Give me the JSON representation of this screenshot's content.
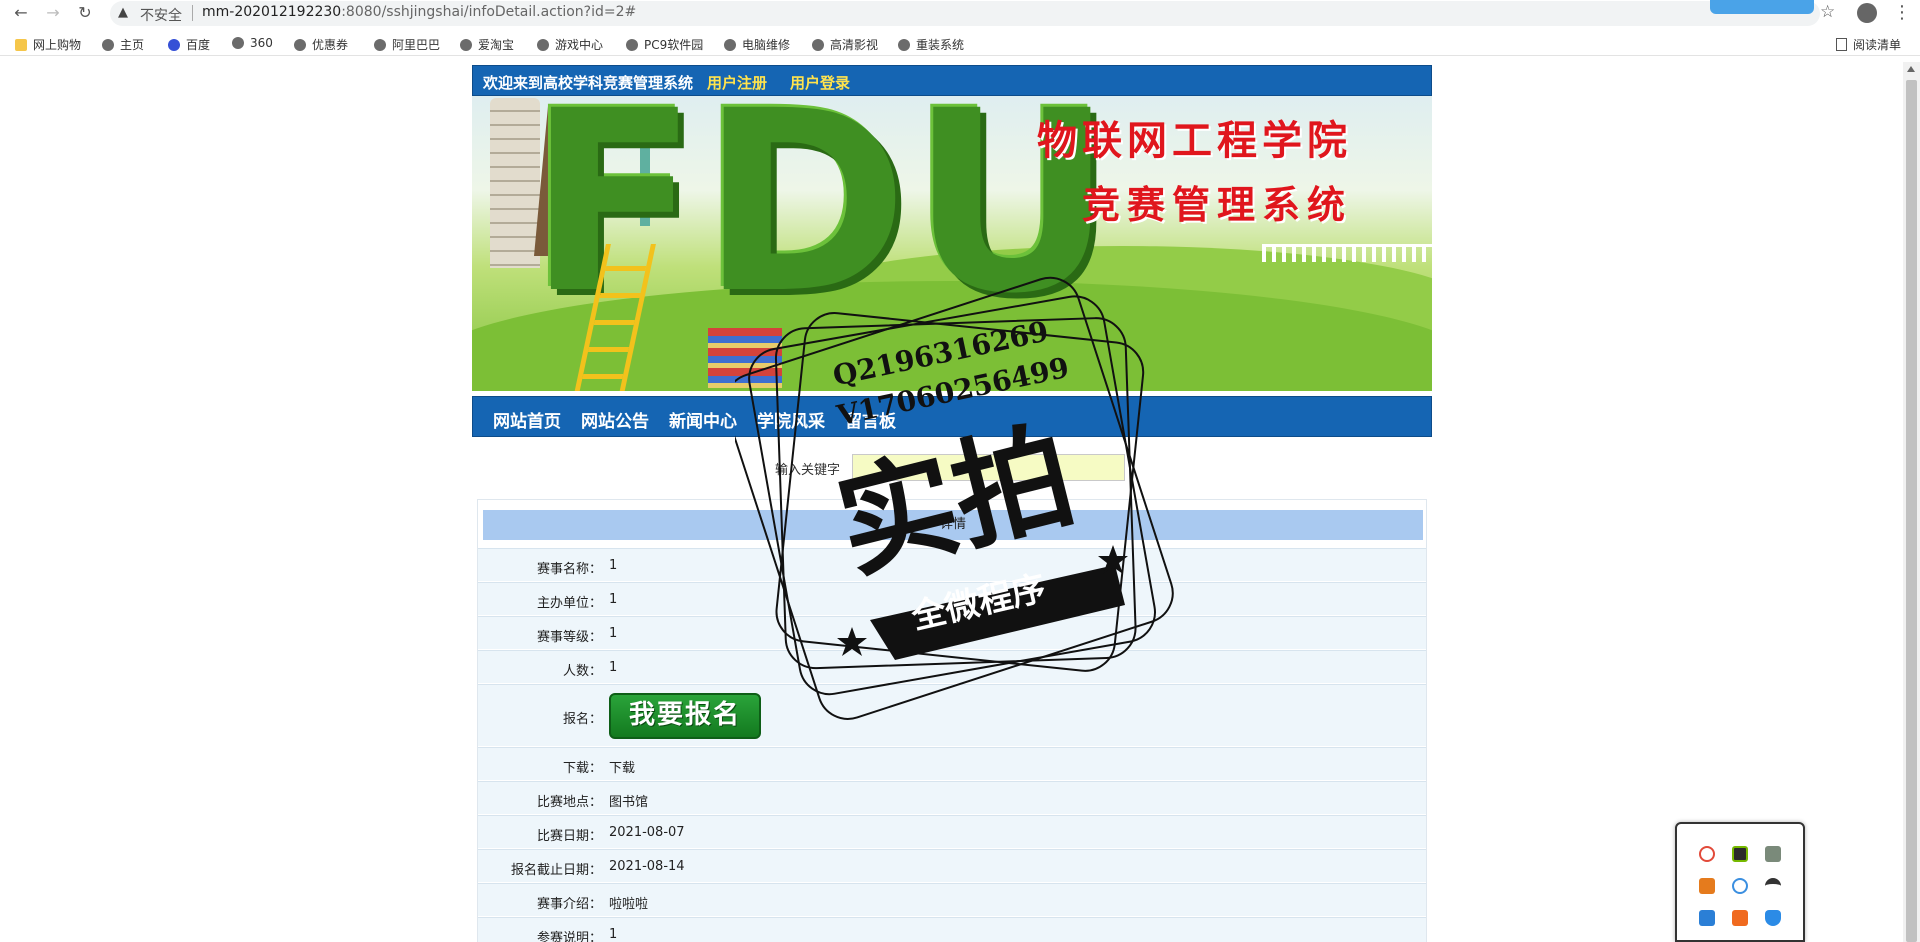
{
  "browser": {
    "insecure_label": "不安全",
    "url_host": "mm-202012192230",
    "url_path": ":8080/sshjingshai/infoDetail.action?id=2#",
    "bookmarks": [
      "网上购物",
      "主页",
      "百度",
      "360",
      "优惠券",
      "阿里巴巴",
      "爱淘宝",
      "游戏中心",
      "PC9软件园",
      "电脑维修",
      "高清影视",
      "重装系统"
    ],
    "reading_list": "阅读清单"
  },
  "header": {
    "welcome": "欢迎来到高校学科竞赛管理系统",
    "register": "用户注册",
    "login": "用户登录"
  },
  "banner": {
    "letters": "FDU",
    "title_line1": "物联网工程学院",
    "title_line2": "竞赛管理系统"
  },
  "nav": [
    "网站首页",
    "网站公告",
    "新闻中心",
    "学院风采",
    "留言板"
  ],
  "search": {
    "label": "输入关键字"
  },
  "detail": {
    "heading": "详情",
    "rows": [
      {
        "label": "赛事名称：",
        "value": "1"
      },
      {
        "label": "主办单位：",
        "value": "1"
      },
      {
        "label": "赛事等级：",
        "value": "1"
      },
      {
        "label": "人数：",
        "value": "1"
      },
      {
        "label": "报名：",
        "value": ""
      },
      {
        "label": "下载：",
        "value": "下载"
      },
      {
        "label": "比赛地点：",
        "value": "图书馆"
      },
      {
        "label": "比赛日期：",
        "value": "2021-08-07"
      },
      {
        "label": "报名截止日期：",
        "value": "2021-08-14"
      },
      {
        "label": "赛事介绍：",
        "value": "啦啦啦"
      },
      {
        "label": "参赛说明：",
        "value": "1"
      }
    ],
    "signup_button": "我要报名"
  },
  "watermark": {
    "line1": "Q2196316269",
    "line2": "V17060256499",
    "main": "实拍",
    "sub": "全微程序"
  }
}
